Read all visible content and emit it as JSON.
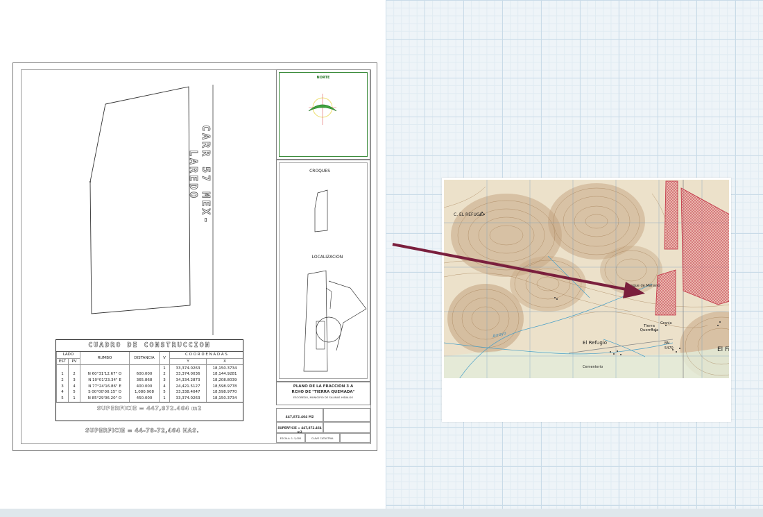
{
  "plan": {
    "road_label": "CARR 57 MEX- LAREDO",
    "norte_label": "NORTE",
    "croques_label": "CROQUES",
    "localizacion_label": "LOCALIZACION"
  },
  "construction_table": {
    "title": "CUADRO DE CONSTRUCCION",
    "headers": {
      "lado": "LADO",
      "est": "EST",
      "pv": "PV",
      "rumbo": "RUMBO",
      "distancia": "DISTANCIA",
      "v": "V",
      "coordenadas": "C O O R D E N A D A S",
      "y": "Y",
      "x": "X"
    },
    "first_row": {
      "v": "1",
      "y": "33,374.0263",
      "x": "18,150.3734"
    },
    "rows": [
      {
        "est": "1",
        "pv": "2",
        "rumbo": "N 60°31'12.67\" O",
        "distancia": "600.000",
        "v": "2",
        "y": "33,374.0036",
        "x": "18,144.9281"
      },
      {
        "est": "2",
        "pv": "3",
        "rumbo": "N 10°01'23.34\" E",
        "distancia": "365.868",
        "v": "3",
        "y": "34,334.2873",
        "x": "18,208.8039"
      },
      {
        "est": "3",
        "pv": "4",
        "rumbo": "N 77°24'16.86\" E",
        "distancia": "400.000",
        "v": "4",
        "y": "24,421.5127",
        "x": "18,598.9778"
      },
      {
        "est": "4",
        "pv": "5",
        "rumbo": "S 00°00'00.15\" O",
        "distancia": "1,080.908",
        "v": "5",
        "y": "33,338.4047",
        "x": "18,598.9770"
      },
      {
        "est": "5",
        "pv": "1",
        "rumbo": "N 85°29'06.20\" O",
        "distancia": "450.000",
        "v": "1",
        "y": "33,374.0263",
        "x": "18,150.3734"
      }
    ],
    "superficie": "SUPERFICIE = 447,872.464 m2"
  },
  "has_label": "SUPERFICIE = 44-78-72,464 HAS.",
  "title_block": {
    "line1": "PLANO DE LA FRACCION 3 A",
    "line2": "RCHO DE \"TIERRA QUEMADA\"",
    "line3": "ESCOBEDO, MUNICIPIO DE SALINAS HIDALGO",
    "area_small": "447,872.464 M2",
    "superficie": "SUPERFICIE = 447,872.464 m2",
    "escala": "ESCALA: 1: 5,000",
    "clave": "CLAVE CATASTRAL"
  },
  "map": {
    "labels": {
      "el_refugio_top": "C. EL REFUGIO",
      "tanque": "Tanque de Mariano",
      "tierra_quemada": "Tierra Quemada",
      "granja": "Granja",
      "el_refugio": "El Refugio",
      "cementerio": "Cementerio",
      "arroyo": "Arroyo",
      "bn": "BN",
      "elev": "5470",
      "elfi": "El Fi"
    }
  },
  "colors": {
    "arrow": "#7a1f3d",
    "parcel_fill": "#e89a9a",
    "parcel_stroke": "#c43c4c",
    "north_arrow": "#3fa33f",
    "map_bg": "#ece1ca",
    "contour": "#a27c52"
  }
}
